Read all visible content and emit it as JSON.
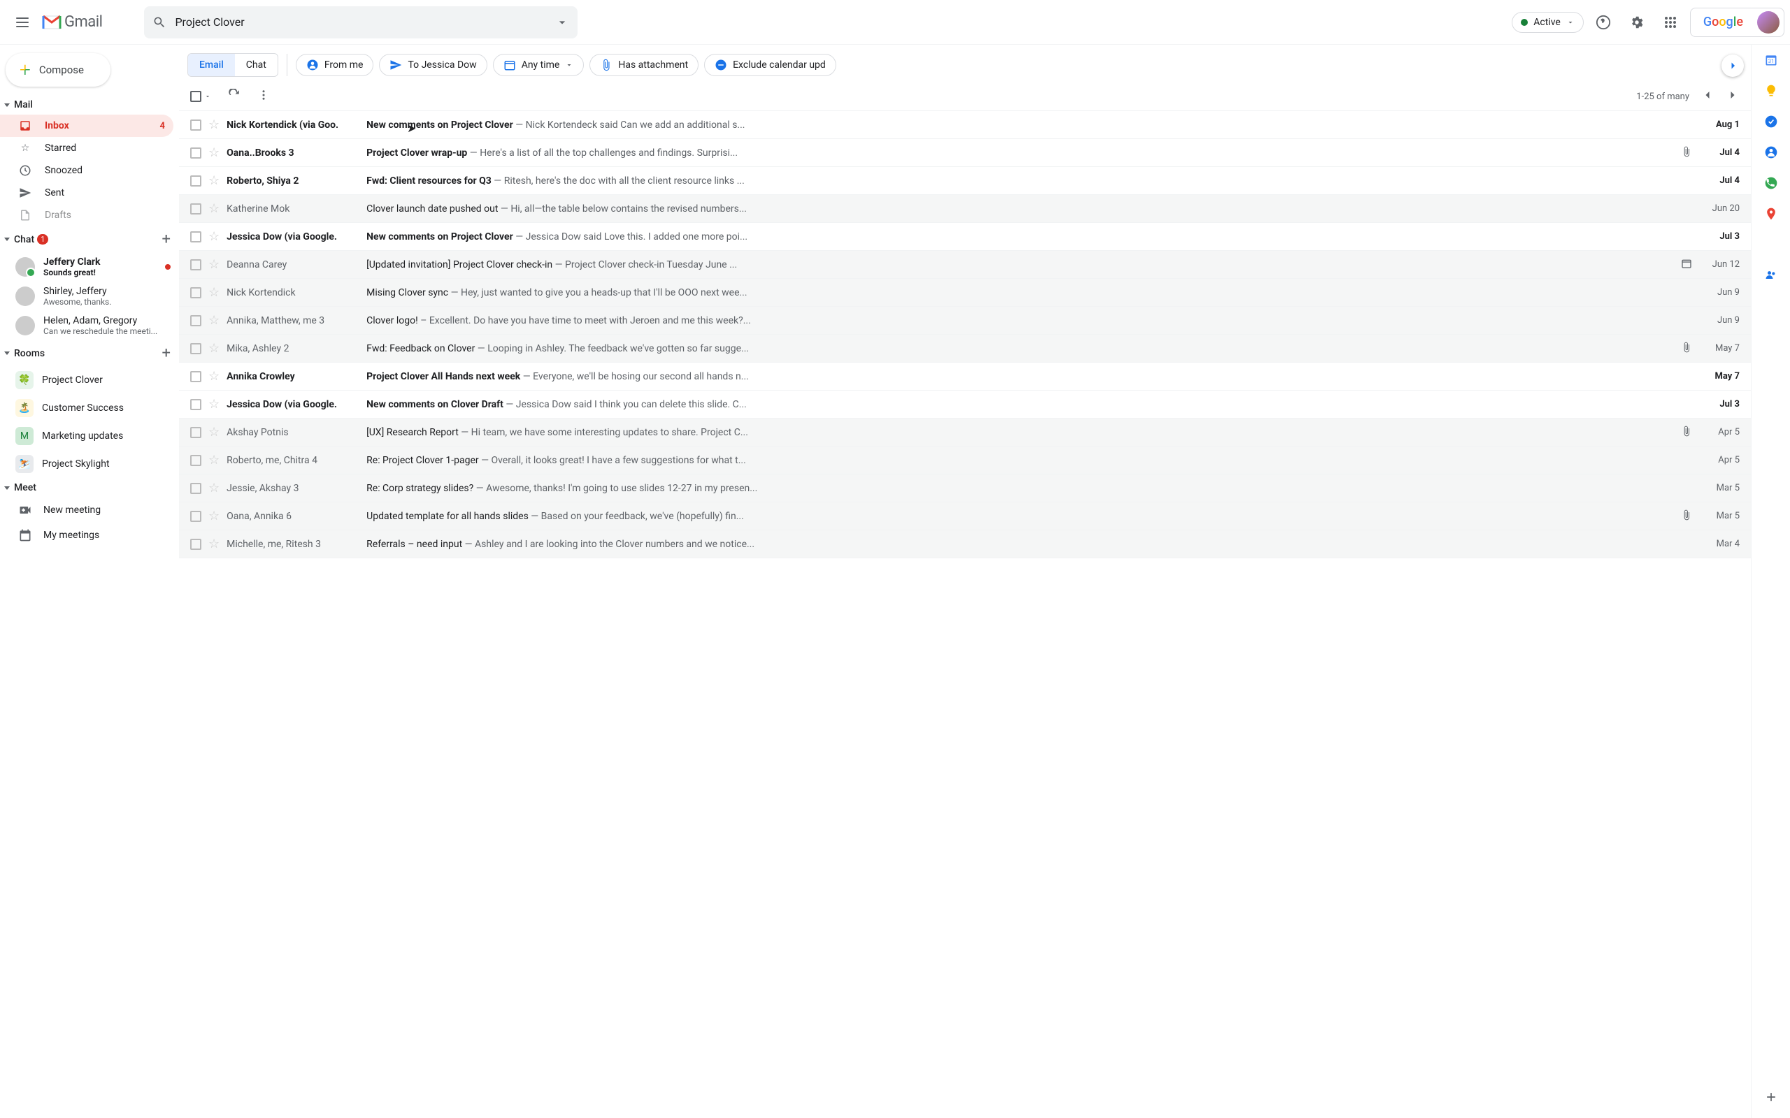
{
  "header": {
    "product": "Gmail",
    "search_value": "Project Clover",
    "status": "Active",
    "google": "Google"
  },
  "compose": "Compose",
  "sections": {
    "mail": "Mail",
    "chat": "Chat",
    "rooms": "Rooms",
    "meet": "Meet"
  },
  "nav": {
    "inbox": {
      "label": "Inbox",
      "count": "4"
    },
    "starred": "Starred",
    "snoozed": "Snoozed",
    "sent": "Sent",
    "drafts": "Drafts"
  },
  "chat_badge": "1",
  "chats": [
    {
      "name": "Jeffery Clark",
      "sub": "Sounds great!",
      "unread": true,
      "dot": true
    },
    {
      "name": "Shirley, Jeffery",
      "sub": "Awesome, thanks."
    },
    {
      "name": "Helen, Adam, Gregory",
      "sub": "Can we reschedule the meeti..."
    }
  ],
  "rooms": [
    {
      "name": "Project Clover",
      "emoji": "🍀",
      "bg": "#e6f4ea"
    },
    {
      "name": "Customer Success",
      "emoji": "🏝️",
      "bg": "#fef7e0"
    },
    {
      "name": "Marketing updates",
      "emoji": "M",
      "bg": "#ceead6",
      "text": "#188038"
    },
    {
      "name": "Project Skylight",
      "emoji": "⛷️",
      "bg": "#e8eaed"
    }
  ],
  "meet": {
    "new": "New meeting",
    "my": "My meetings"
  },
  "tabs": {
    "email": "Email",
    "chat": "Chat"
  },
  "chips": {
    "from": "From me",
    "to": "To Jessica Dow",
    "any": "Any time",
    "attach": "Has attachment",
    "exclude": "Exclude calendar upd"
  },
  "pagination": "1-25 of many",
  "emails": [
    {
      "s": "Nick Kortendick (via Goo.",
      "sub": "New comments on Project Clover",
      "sn": " — Nick Kortendeck said Can we add an additional s...",
      "d": "Aug 1",
      "u": true
    },
    {
      "s": "Oana..Brooks 3",
      "sub": "Project Clover wrap-up",
      "sn": " — Here's a list of all the top challenges and findings. Surprisi...",
      "d": "Jul 4",
      "u": true,
      "a": true
    },
    {
      "s": "Roberto, Shiya 2",
      "sub": "Fwd: Client resources for Q3",
      "sn": " — Ritesh, here's the doc with all the client resource links ...",
      "d": "Jul 4",
      "u": true
    },
    {
      "s": "Katherine Mok",
      "sub": "Clover launch date pushed out",
      "sn": " — Hi, all—the table below contains the revised numbers...",
      "d": "Jun 20"
    },
    {
      "s": "Jessica Dow (via Google.",
      "sub": "New comments on Project Clover",
      "sn": " — Jessica Dow said Love this. I added one more poi...",
      "d": "Jul 3",
      "u": true
    },
    {
      "s": "Deanna Carey",
      "sub": "[Updated invitation] Project Clover check-in",
      "sn": " — Project Clover check-in Tuesday June ...",
      "d": "Jun 12",
      "cal": true
    },
    {
      "s": "Nick Kortendick",
      "sub": "Mising Clover sync",
      "sn": " — Hey, just wanted to give you a heads-up that I'll be OOO next wee...",
      "d": "Jun 9"
    },
    {
      "s": "Annika, Matthew, me 3",
      "sub": "Clover logo!",
      "sn": " – Excellent. Do have you have time to meet with Jeroen and me this week?...",
      "d": "Jun 9"
    },
    {
      "s": "Mika, Ashley 2",
      "sub": "Fwd: Feedback on Clover",
      "sn": " — Looping in Ashley. The feedback we've gotten so far sugge...",
      "d": "May 7",
      "a": true
    },
    {
      "s": "Annika Crowley",
      "sub": "Project Clover All Hands next week",
      "sn": " — Everyone, we'll be hosing our second all hands n...",
      "d": "May 7",
      "u": true
    },
    {
      "s": "Jessica Dow (via Google.",
      "sub": "New comments on Clover Draft",
      "sn": " — Jessica Dow said I think you can delete this slide. C...",
      "d": "Jul 3",
      "u": true
    },
    {
      "s": "Akshay Potnis",
      "sub": "[UX] Research Report",
      "sn": " — Hi team, we have some interesting updates to share. Project C...",
      "d": "Apr 5",
      "a": true
    },
    {
      "s": "Roberto, me, Chitra 4",
      "sub": "Re: Project Clover 1-pager",
      "sn": " — Overall, it looks great! I have a few suggestions for what t...",
      "d": "Apr 5"
    },
    {
      "s": "Jessie, Akshay 3",
      "sub": "Re: Corp strategy slides?",
      "sn": " — Awesome, thanks! I'm going to use slides 12-27 in my presen...",
      "d": "Mar 5"
    },
    {
      "s": "Oana, Annika 6",
      "sub": "Updated template for all hands slides",
      "sn": " — Based on your feedback, we've (hopefully) fin...",
      "d": "Mar 5",
      "a": true
    },
    {
      "s": "Michelle, me, Ritesh 3",
      "sub": "Referrals – need input",
      "sn": " — Ashley and I are looking into the Clover numbers and we notice...",
      "d": "Mar 4"
    }
  ]
}
